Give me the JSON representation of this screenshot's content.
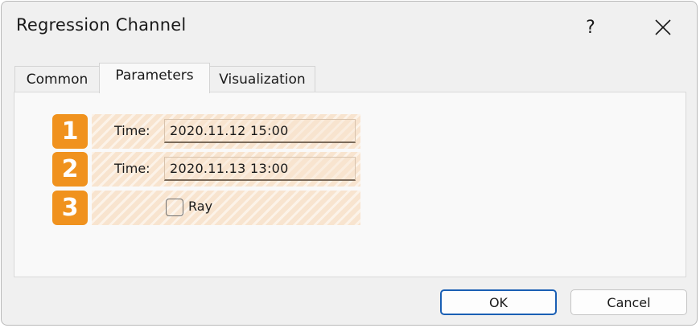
{
  "window": {
    "title": "Regression Channel",
    "help_glyph": "?"
  },
  "tabs": [
    {
      "label": "Common"
    },
    {
      "label": "Parameters"
    },
    {
      "label": "Visualization"
    }
  ],
  "active_tab": "Parameters",
  "params": {
    "rows": [
      {
        "badge": "1",
        "label": "Time:",
        "value": "2020.11.12 15:00"
      },
      {
        "badge": "2",
        "label": "Time:",
        "value": "2020.11.13 13:00"
      },
      {
        "badge": "3",
        "checkbox_label": "Ray",
        "checked": false
      }
    ]
  },
  "buttons": {
    "ok": "OK",
    "cancel": "Cancel"
  },
  "colors": {
    "badge": "#f0921e",
    "highlight": "#f8e4cf",
    "default_button_border": "#1a5fb4"
  }
}
